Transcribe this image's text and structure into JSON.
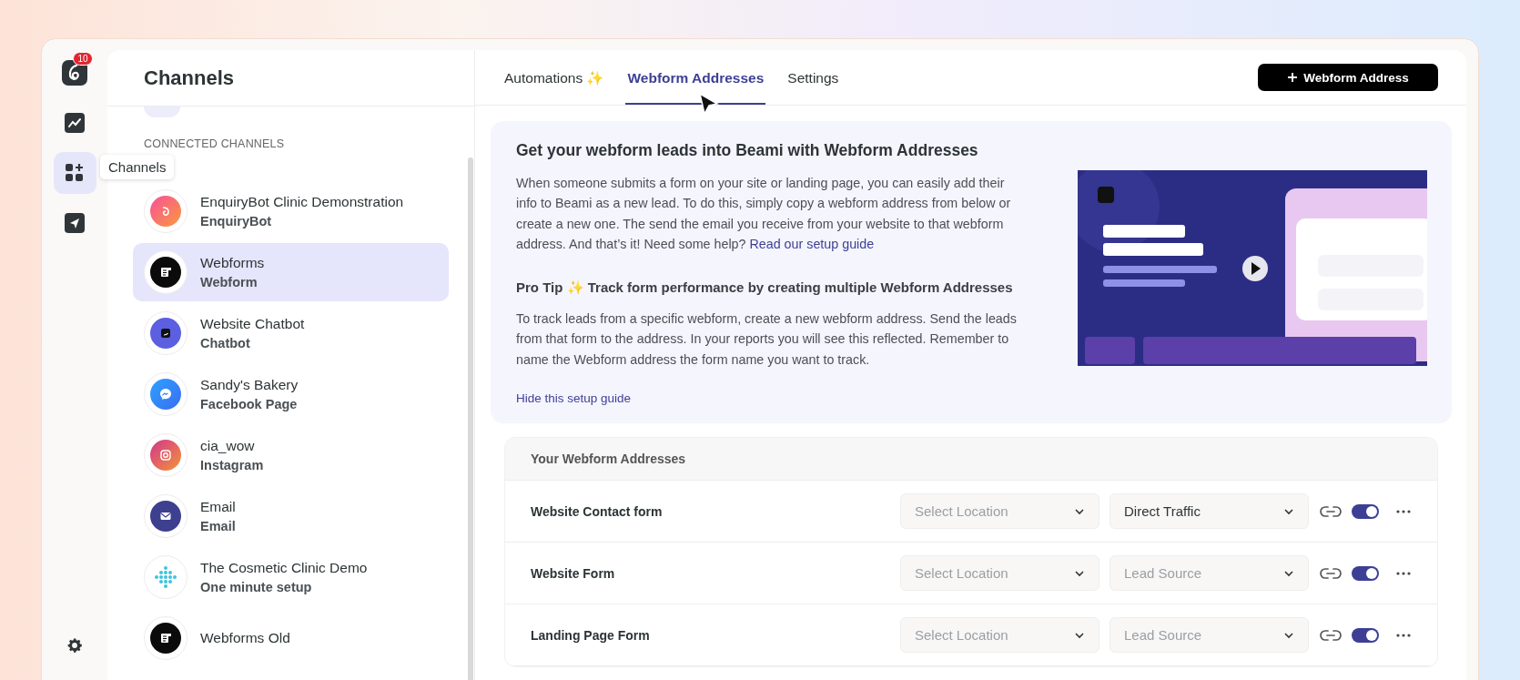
{
  "rail": {
    "items": [
      {
        "kind": "logo",
        "badge": "10",
        "selected": false
      },
      {
        "kind": "analytics",
        "selected": false
      },
      {
        "kind": "channels",
        "selected": true
      },
      {
        "kind": "send",
        "selected": false
      }
    ],
    "tooltip": "Channels"
  },
  "sidebar": {
    "title": "Channels",
    "section": "CONNECTED CHANNELS",
    "channels": [
      {
        "name": "EnquiryBot Clinic Demonstration",
        "type": "EnquiryBot",
        "kind": "enquirybot",
        "selected": false
      },
      {
        "name": "Webforms",
        "type": "Webform",
        "kind": "webform",
        "selected": true
      },
      {
        "name": "Website Chatbot",
        "type": "Chatbot",
        "kind": "chatbot",
        "selected": false
      },
      {
        "name": "Sandy's Bakery",
        "type": "Facebook Page",
        "kind": "messenger",
        "selected": false
      },
      {
        "name": "cia_wow",
        "type": "Instagram",
        "kind": "instagram",
        "selected": false
      },
      {
        "name": "Email",
        "type": "Email",
        "kind": "email",
        "selected": false
      },
      {
        "name": "The Cosmetic Clinic Demo",
        "type": "One minute setup",
        "kind": "dots",
        "selected": false
      },
      {
        "name": "Webforms Old",
        "kind": "webform",
        "selected": false
      }
    ]
  },
  "tabs": [
    {
      "label": "Automations ✨",
      "selected": false
    },
    {
      "label": "Webform Addresses",
      "selected": true
    },
    {
      "label": "Settings",
      "selected": false
    }
  ],
  "add_button": "Webform Address",
  "guide": {
    "title": "Get your webform leads into Beami with Webform Addresses",
    "intro": "When someone submits a form on your site or landing page, you can easily add their info to Beami as a new lead. To do this, simply copy a webform address from below or create a new one. The send the email you receive from your website to that webform address. And that’s it! Need some help? ",
    "intro_link": "Read our setup guide",
    "tip_title": "Pro Tip ✨ Track form performance by creating multiple Webform Addresses",
    "tip": "To track leads from a specific webform, create a new webform address. Send the leads from that form to the address. In your reports you will see this reflected. Remember to name the Webform address the form name you want to track.",
    "hide_link": "Hide this setup guide"
  },
  "table": {
    "title": "Your Webform Addresses",
    "rows": [
      {
        "name": "Website Contact form",
        "location": {
          "placeholder": "Select Location"
        },
        "source": {
          "value": "Direct Traffic"
        },
        "on": true
      },
      {
        "name": "Website Form",
        "location": {
          "placeholder": "Select Location"
        },
        "source": {
          "placeholder": "Lead Source"
        },
        "on": true
      },
      {
        "name": "Landing Page Form",
        "location": {
          "placeholder": "Select Location"
        },
        "source": {
          "placeholder": "Lead Source"
        },
        "on": true
      }
    ]
  }
}
